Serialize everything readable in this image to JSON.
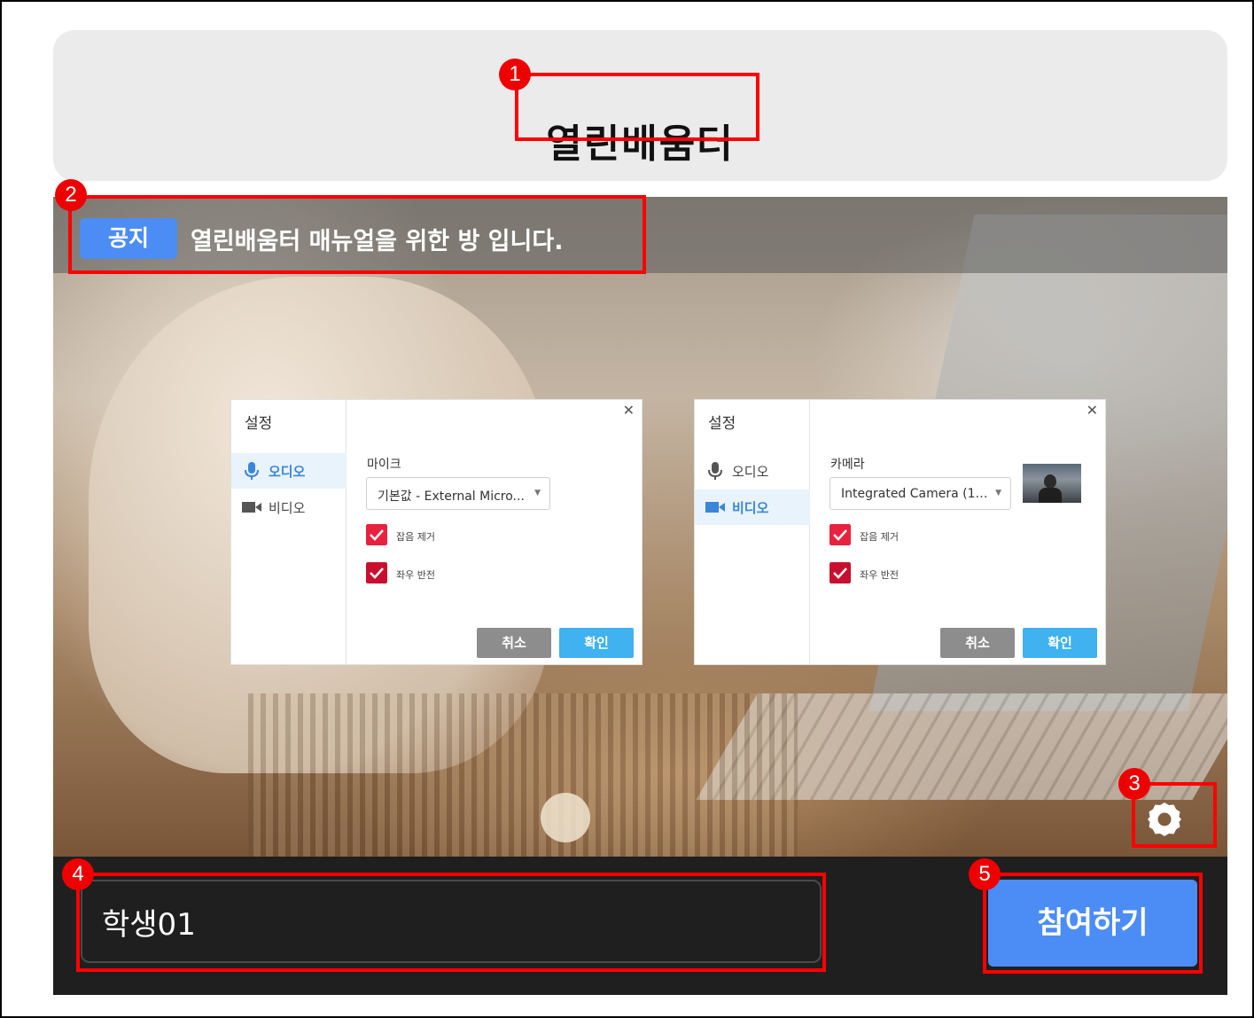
{
  "header": {
    "room_title": "열린배움터"
  },
  "notice": {
    "badge": "공지",
    "text": "열린배움터 매뉴얼을 위한 방 입니다."
  },
  "dialogs": [
    {
      "title": "설정",
      "nav": [
        {
          "label": "오디오",
          "icon": "mic-icon"
        },
        {
          "label": "비디오",
          "icon": "video-camera-icon"
        }
      ],
      "active": "오디오",
      "field_label": "마이크",
      "select_value": "기본값 - External Micro...",
      "checks": [
        {
          "label": "잡음 제거",
          "checked": true
        },
        {
          "label": "좌우 반전",
          "checked": true
        }
      ],
      "cancel": "취소",
      "ok": "확인"
    },
    {
      "title": "설정",
      "nav": [
        {
          "label": "오디오",
          "icon": "mic-icon"
        },
        {
          "label": "비디오",
          "icon": "video-camera-icon"
        }
      ],
      "active": "비디오",
      "field_label": "카메라",
      "select_value": "Integrated Camera (13...",
      "checks": [
        {
          "label": "잡음 제거",
          "checked": true
        },
        {
          "label": "좌우 반전",
          "checked": true
        }
      ],
      "cancel": "취소",
      "ok": "확인"
    }
  ],
  "join": {
    "name_value": "학생01",
    "button": "참여하기"
  },
  "annotations": {
    "markers": [
      "1",
      "2",
      "3",
      "4",
      "5"
    ]
  },
  "colors": {
    "accent": "#4c8cf5",
    "checkbox": "#e8213f",
    "highlight": "#ff0000",
    "ok_button": "#3fb2ef"
  }
}
